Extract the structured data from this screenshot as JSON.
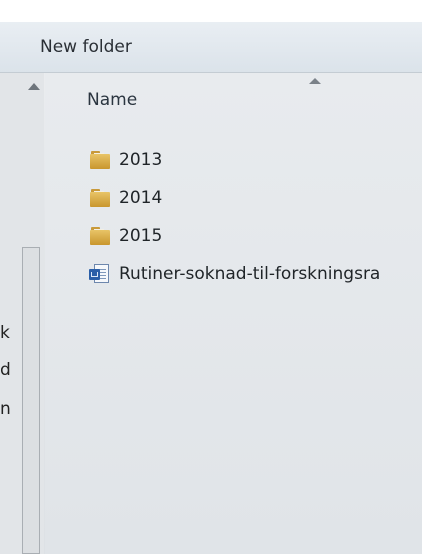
{
  "toolbar": {
    "new_folder_label": "New folder"
  },
  "navigation_pane": {
    "truncated_labels": [
      "k",
      "d",
      "n"
    ]
  },
  "file_list": {
    "column_header": "Name",
    "items": [
      {
        "name": "2013",
        "type": "folder",
        "icon": "folder-icon"
      },
      {
        "name": "2014",
        "type": "folder",
        "icon": "folder-icon"
      },
      {
        "name": "2015",
        "type": "folder",
        "icon": "folder-icon"
      },
      {
        "name": "Rutiner-soknad-til-forskningsra",
        "type": "document",
        "icon": "word-document-icon"
      }
    ]
  },
  "colors": {
    "toolbar_bg": "#dbe3ea",
    "folder": "#d9ad4d",
    "doc_badge": "#2b5fa8",
    "text": "#1f2428"
  }
}
